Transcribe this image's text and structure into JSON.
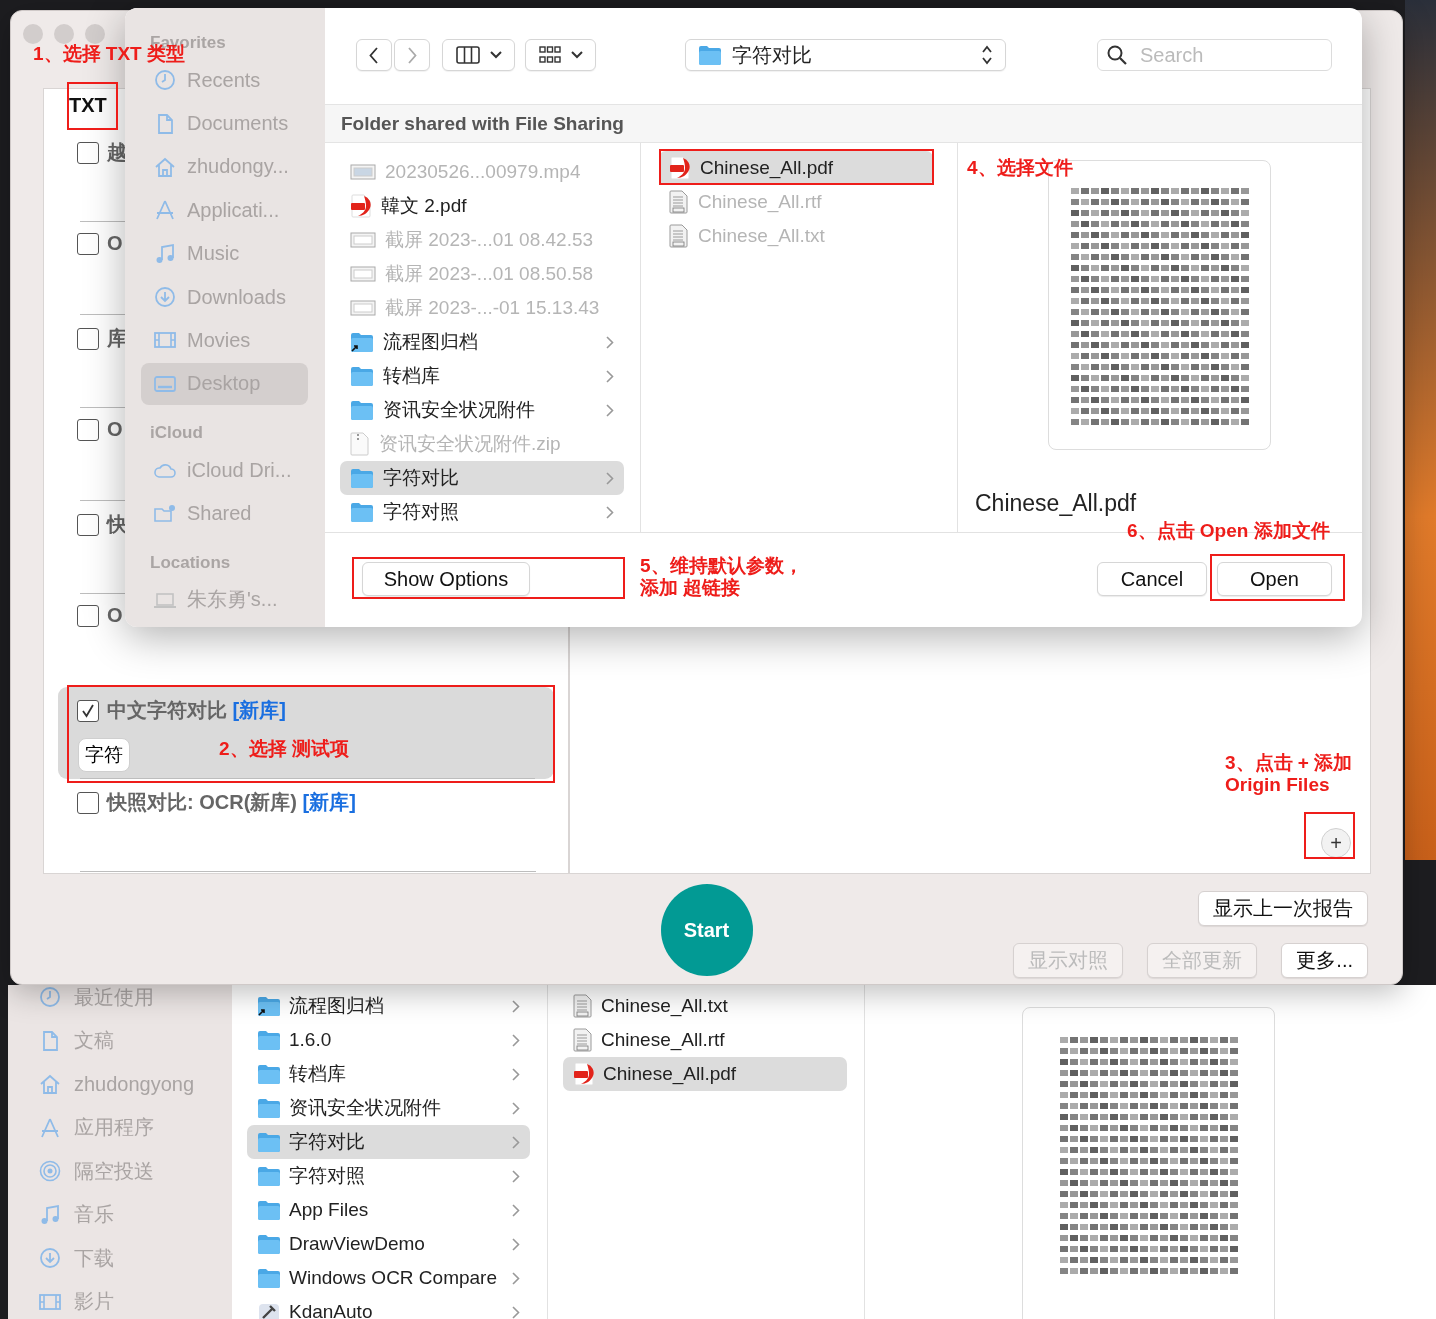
{
  "finder_back": {
    "sidebar": [
      {
        "label": "最近使用",
        "kind": "recents"
      },
      {
        "label": "文稿",
        "kind": "document"
      },
      {
        "label": "zhudongyong",
        "kind": "home"
      },
      {
        "label": "应用程序",
        "kind": "apps"
      },
      {
        "label": "隔空投送",
        "kind": "airdrop"
      },
      {
        "label": "音乐",
        "kind": "music"
      },
      {
        "label": "下载",
        "kind": "downloads"
      },
      {
        "label": "影片",
        "kind": "movies"
      }
    ],
    "folders": [
      {
        "label": "流程图归档",
        "kind": "alias-folder",
        "selected": false
      },
      {
        "label": "1.6.0",
        "kind": "folder",
        "selected": false
      },
      {
        "label": "转档库",
        "kind": "folder",
        "selected": false
      },
      {
        "label": "资讯安全状况附件",
        "kind": "folder",
        "selected": false
      },
      {
        "label": "字符对比",
        "kind": "folder",
        "selected": true
      },
      {
        "label": "字符对照",
        "kind": "folder",
        "selected": false
      },
      {
        "label": "App Files",
        "kind": "folder",
        "selected": false
      },
      {
        "label": "DrawViewDemo",
        "kind": "folder",
        "selected": false
      },
      {
        "label": "Windows OCR Compare",
        "kind": "folder",
        "selected": false
      },
      {
        "label": "KdanAuto",
        "kind": "app",
        "selected": false
      }
    ],
    "files": [
      {
        "label": "Chinese_All.txt",
        "kind": "txt",
        "selected": false
      },
      {
        "label": "Chinese_All.rtf",
        "kind": "rtf",
        "selected": false
      },
      {
        "label": "Chinese_All.pdf",
        "kind": "pdf",
        "selected": true
      }
    ]
  },
  "app_window": {
    "list_header": "TXT",
    "rows": [
      {
        "label": "越",
        "checked": false
      },
      {
        "label": "O",
        "checked": false
      },
      {
        "label": "库",
        "checked": false
      },
      {
        "label": "O",
        "checked": false
      },
      {
        "label": "快",
        "checked": false
      },
      {
        "label": "O",
        "checked": false
      }
    ],
    "selected_test": {
      "label": "中文字符对比",
      "tag": "[新库]",
      "checked": true,
      "chip": "字符"
    },
    "last_test": {
      "label": "快照对比: OCR(新库)",
      "tag": "[新库]",
      "checked": false
    },
    "add_button": "+",
    "start_button": "Start",
    "report_button": {
      "label": "显示上一次报告",
      "disabled": false
    },
    "buttons": [
      {
        "label": "显示对照",
        "disabled": true
      },
      {
        "label": "全部更新",
        "disabled": true
      },
      {
        "label": "更多...",
        "disabled": false
      }
    ]
  },
  "open_dialog": {
    "sidebar": [
      {
        "heading": "Favorites",
        "items": [
          {
            "label": "Recents",
            "kind": "recents",
            "selected": false
          },
          {
            "label": "Documents",
            "kind": "document",
            "selected": false
          },
          {
            "label": "zhudongy...",
            "kind": "home",
            "selected": false
          },
          {
            "label": "Applicati...",
            "kind": "apps",
            "selected": false
          },
          {
            "label": "Music",
            "kind": "music",
            "selected": false
          },
          {
            "label": "Downloads",
            "kind": "downloads",
            "selected": false
          },
          {
            "label": "Movies",
            "kind": "movies",
            "selected": false
          },
          {
            "label": "Desktop",
            "kind": "desktop",
            "selected": true
          }
        ]
      },
      {
        "heading": "iCloud",
        "items": [
          {
            "label": "iCloud Dri...",
            "kind": "cloud",
            "selected": false
          },
          {
            "label": "Shared",
            "kind": "shared",
            "selected": false
          }
        ]
      },
      {
        "heading": "Locations",
        "items": [
          {
            "label": "朱东勇's...",
            "kind": "computer",
            "selected": false
          }
        ]
      }
    ],
    "location": "字符对比",
    "search": {
      "placeholder": "Search"
    },
    "path_header": "Folder shared with File Sharing",
    "column_1": [
      {
        "label": "20230526...00979.mp4",
        "kind": "video",
        "selected": false,
        "disabled": true,
        "chevron": false
      },
      {
        "label": "韓文 2.pdf",
        "kind": "pdf",
        "selected": false,
        "disabled": false,
        "chevron": false
      },
      {
        "label": "截屏 2023-...01 08.42.53",
        "kind": "image",
        "selected": false,
        "disabled": true,
        "chevron": false
      },
      {
        "label": "截屏 2023-...01 08.50.58",
        "kind": "image",
        "selected": false,
        "disabled": true,
        "chevron": false
      },
      {
        "label": "截屏 2023-...-01 15.13.43",
        "kind": "image",
        "selected": false,
        "disabled": true,
        "chevron": false
      },
      {
        "label": "流程图归档",
        "kind": "alias-folder",
        "selected": false,
        "disabled": false,
        "chevron": true
      },
      {
        "label": "转档库",
        "kind": "folder",
        "selected": false,
        "disabled": false,
        "chevron": true
      },
      {
        "label": "资讯安全状况附件",
        "kind": "folder",
        "selected": false,
        "disabled": false,
        "chevron": true
      },
      {
        "label": "资讯安全状况附件.zip",
        "kind": "zip",
        "selected": false,
        "disabled": true,
        "chevron": false
      },
      {
        "label": "字符对比",
        "kind": "folder",
        "selected": true,
        "disabled": false,
        "chevron": true
      },
      {
        "label": "字符对照",
        "kind": "folder",
        "selected": false,
        "disabled": false,
        "chevron": true
      }
    ],
    "column_2": [
      {
        "label": "Chinese_All.pdf",
        "kind": "pdf",
        "selected": true,
        "disabled": false
      },
      {
        "label": "Chinese_All.rtf",
        "kind": "rtf",
        "selected": false,
        "disabled": true
      },
      {
        "label": "Chinese_All.txt",
        "kind": "txt",
        "selected": false,
        "disabled": true
      }
    ],
    "preview_name": "Chinese_All.pdf",
    "show_options_button": "Show Options",
    "cancel_button": "Cancel",
    "open_button": "Open"
  },
  "annotations": [
    {
      "lines": [
        "1、选择 TXT 类型"
      ]
    },
    {
      "lines": [
        "2、选择 测试项"
      ]
    },
    {
      "lines": [
        "3、点击 + 添加",
        "Origin Files"
      ]
    },
    {
      "lines": [
        "4、选择文件"
      ]
    },
    {
      "lines": [
        "5、维持默认参数，",
        "添加 超链接"
      ]
    },
    {
      "lines": [
        "6、点击 Open 添加文件"
      ]
    }
  ]
}
